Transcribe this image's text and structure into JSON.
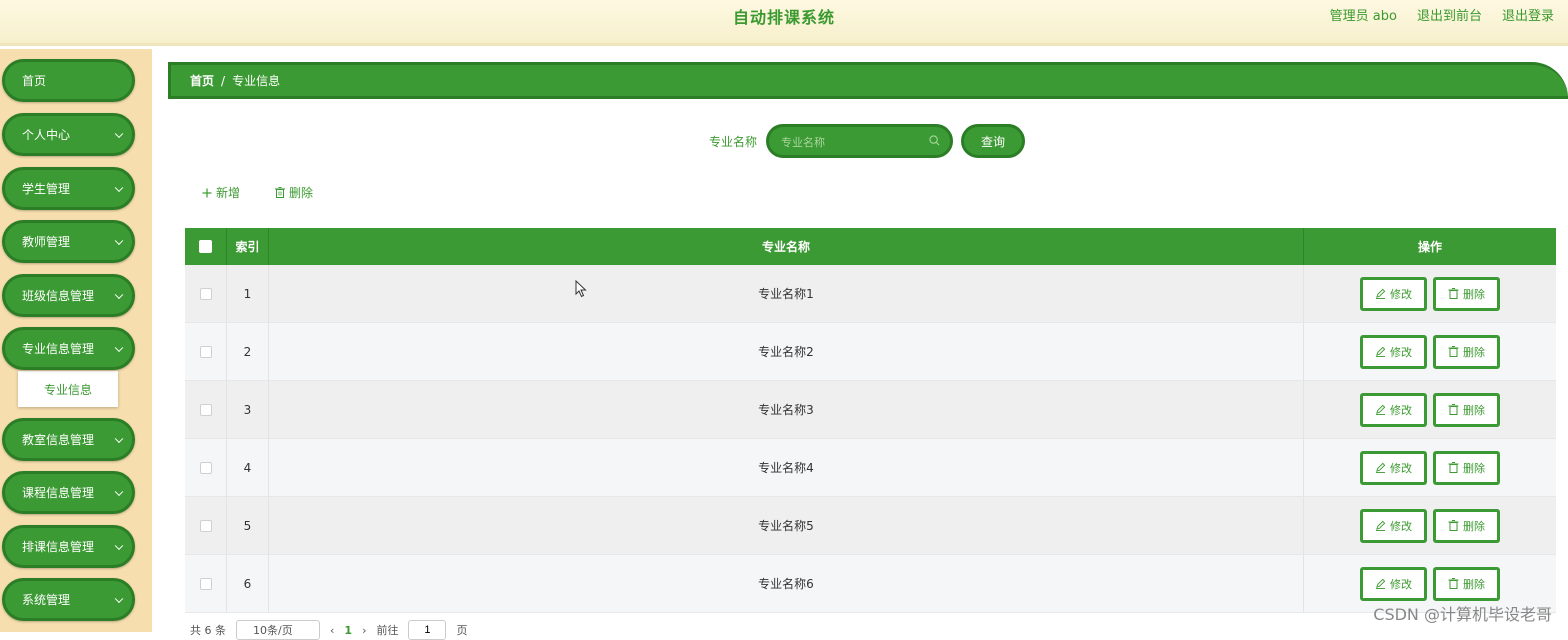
{
  "header": {
    "title": "自动排课系统",
    "links": [
      "管理员 abo",
      "退出到前台",
      "退出登录"
    ]
  },
  "sidebar": {
    "items": [
      {
        "label": "首页",
        "has_arrow": false
      },
      {
        "label": "个人中心",
        "has_arrow": true
      },
      {
        "label": "学生管理",
        "has_arrow": true
      },
      {
        "label": "教师管理",
        "has_arrow": true
      },
      {
        "label": "班级信息管理",
        "has_arrow": true
      },
      {
        "label": "专业信息管理",
        "has_arrow": true
      },
      {
        "label": "教室信息管理",
        "has_arrow": true
      },
      {
        "label": "课程信息管理",
        "has_arrow": true
      },
      {
        "label": "排课信息管理",
        "has_arrow": true
      },
      {
        "label": "系统管理",
        "has_arrow": true
      }
    ],
    "submenu": {
      "label": "专业信息"
    }
  },
  "breadcrumb": {
    "home": "首页",
    "separator": "/",
    "current": "专业信息"
  },
  "search": {
    "label": "专业名称",
    "placeholder": "专业名称",
    "button": "查询"
  },
  "toolbar": {
    "add_label": "新增",
    "delete_label": "删除"
  },
  "table": {
    "headers": {
      "index": "索引",
      "name": "专业名称",
      "actions": "操作"
    },
    "rows": [
      {
        "index": "1",
        "name": "专业名称1"
      },
      {
        "index": "2",
        "name": "专业名称2"
      },
      {
        "index": "3",
        "name": "专业名称3"
      },
      {
        "index": "4",
        "name": "专业名称4"
      },
      {
        "index": "5",
        "name": "专业名称5"
      },
      {
        "index": "6",
        "name": "专业名称6"
      }
    ],
    "edit_label": "修改",
    "delete_label": "删除"
  },
  "pagination": {
    "total": "共 6 条",
    "page_size": "10条/页",
    "current_page": "1",
    "goto": "前往",
    "goto_value": "1",
    "page_unit": "页"
  },
  "watermark": "CSDN @计算机毕设老哥",
  "colors": {
    "primary": "#3c9a34",
    "border": "#2b7d26",
    "sidebar_bg": "#f6deae",
    "header_bg": "#fdf8e2"
  }
}
